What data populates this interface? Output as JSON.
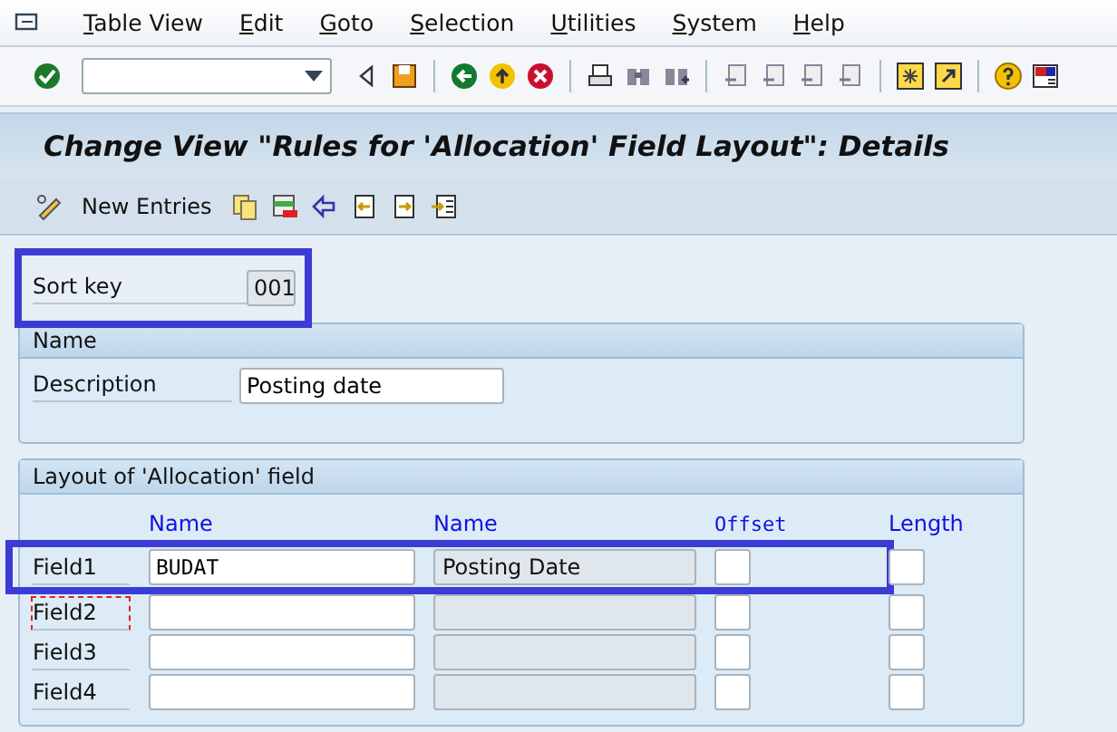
{
  "menu": [
    {
      "label": "Table View"
    },
    {
      "label": "Edit"
    },
    {
      "label": "Goto"
    },
    {
      "label": "Selection"
    },
    {
      "label": "Utilities"
    },
    {
      "label": "System"
    },
    {
      "label": "Help"
    }
  ],
  "title": "Change View \"Rules for 'Allocation' Field Layout\": Details",
  "app_toolbar": {
    "new_entries": "New Entries"
  },
  "sort_key": {
    "label": "Sort key",
    "value": "001",
    "highlighted": true
  },
  "name_group": {
    "title": "Name",
    "label": "Description",
    "value": "Posting date"
  },
  "layout_group": {
    "title": "Layout of 'Allocation' field",
    "columns": [
      "Name",
      "Name",
      "Offset",
      "Length"
    ],
    "rows": [
      {
        "label": "Field1",
        "name": "BUDAT",
        "description": "Posting Date",
        "offset": "",
        "length": "",
        "highlighted": true,
        "focused": false
      },
      {
        "label": "Field2",
        "name": "",
        "description": "",
        "offset": "",
        "length": "",
        "highlighted": false,
        "focused": true
      },
      {
        "label": "Field3",
        "name": "",
        "description": "",
        "offset": "",
        "length": "",
        "highlighted": false,
        "focused": false
      },
      {
        "label": "Field4",
        "name": "",
        "description": "",
        "offset": "",
        "length": "",
        "highlighted": false,
        "focused": false
      }
    ]
  }
}
